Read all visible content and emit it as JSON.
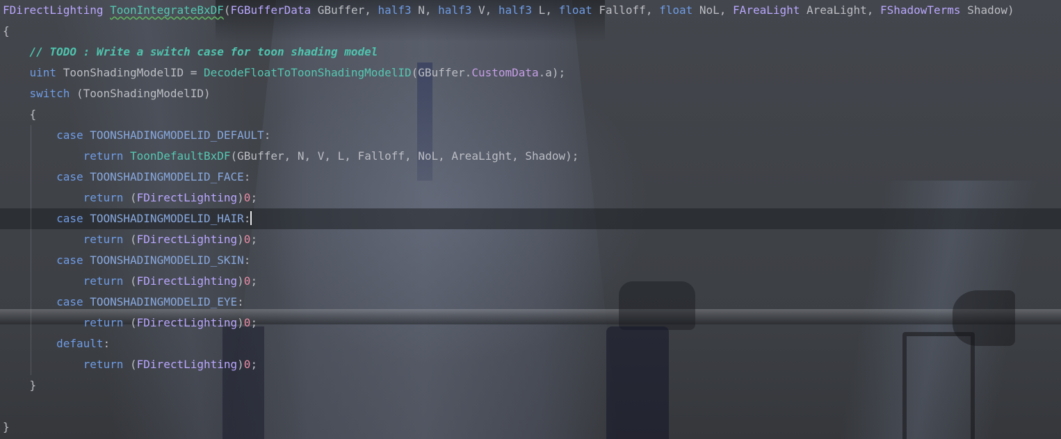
{
  "editor": {
    "lines": [
      [
        [
          "FDirectLighting",
          "ty"
        ],
        [
          " ",
          "id"
        ],
        [
          "ToonIntegrateBxDF",
          "fn squiggle"
        ],
        [
          "(",
          "id"
        ],
        [
          "FGBufferData",
          "ty"
        ],
        [
          " GBuffer, ",
          "id"
        ],
        [
          "half3",
          "kw"
        ],
        [
          " N, ",
          "id"
        ],
        [
          "half3",
          "kw"
        ],
        [
          " V, ",
          "id"
        ],
        [
          "half3",
          "kw"
        ],
        [
          " L, ",
          "id"
        ],
        [
          "float",
          "kw"
        ],
        [
          " Falloff, ",
          "id"
        ],
        [
          "float",
          "kw"
        ],
        [
          " NoL, ",
          "id"
        ],
        [
          "FAreaLight",
          "ty"
        ],
        [
          " AreaLight, ",
          "id"
        ],
        [
          "FShadowTerms",
          "ty"
        ],
        [
          " Shadow)",
          "id"
        ]
      ],
      [
        [
          "{",
          "id"
        ]
      ],
      [
        [
          "    ",
          "id"
        ],
        [
          "// TODO : Write a switch case for toon shading model",
          "cm"
        ]
      ],
      [
        [
          "    ",
          "id"
        ],
        [
          "uint",
          "kw"
        ],
        [
          " ToonShadingModelID = ",
          "id"
        ],
        [
          "DecodeFloatToToonShadingModelID",
          "fn"
        ],
        [
          "(GBuffer.",
          "id"
        ],
        [
          "CustomData",
          "fld"
        ],
        [
          ".a);",
          "id"
        ]
      ],
      [
        [
          "    ",
          "id"
        ],
        [
          "switch",
          "kw"
        ],
        [
          " (ToonShadingModelID)",
          "id"
        ]
      ],
      [
        [
          "    {",
          "id"
        ]
      ],
      [
        [
          "        ",
          "id"
        ],
        [
          "case",
          "kw"
        ],
        [
          " ",
          "id"
        ],
        [
          "TOONSHADINGMODELID_DEFAULT",
          "mac"
        ],
        [
          ":",
          "id"
        ]
      ],
      [
        [
          "            ",
          "id"
        ],
        [
          "return",
          "kw"
        ],
        [
          " ",
          "id"
        ],
        [
          "ToonDefaultBxDF",
          "fn"
        ],
        [
          "(GBuffer, N, V, L, Falloff, NoL, AreaLight, Shadow);",
          "id"
        ]
      ],
      [
        [
          "        ",
          "id"
        ],
        [
          "case",
          "kw"
        ],
        [
          " ",
          "id"
        ],
        [
          "TOONSHADINGMODELID_FACE",
          "mac"
        ],
        [
          ":",
          "id"
        ]
      ],
      [
        [
          "            ",
          "id"
        ],
        [
          "return",
          "kw"
        ],
        [
          " (",
          "id"
        ],
        [
          "FDirectLighting",
          "ty"
        ],
        [
          ")",
          "id"
        ],
        [
          "0",
          "num"
        ],
        [
          ";",
          "id"
        ]
      ],
      [
        [
          "        ",
          "id"
        ],
        [
          "case",
          "kw"
        ],
        [
          " ",
          "id"
        ],
        [
          "TOONSHADINGMODELID_HAIR",
          "mac"
        ],
        [
          ":",
          "id"
        ]
      ],
      [
        [
          "            ",
          "id"
        ],
        [
          "return",
          "kw"
        ],
        [
          " (",
          "id"
        ],
        [
          "FDirectLighting",
          "ty"
        ],
        [
          ")",
          "id"
        ],
        [
          "0",
          "num"
        ],
        [
          ";",
          "id"
        ]
      ],
      [
        [
          "        ",
          "id"
        ],
        [
          "case",
          "kw"
        ],
        [
          " ",
          "id"
        ],
        [
          "TOONSHADINGMODELID_SKIN",
          "mac"
        ],
        [
          ":",
          "id"
        ]
      ],
      [
        [
          "            ",
          "id"
        ],
        [
          "return",
          "kw"
        ],
        [
          " (",
          "id"
        ],
        [
          "FDirectLighting",
          "ty"
        ],
        [
          ")",
          "id"
        ],
        [
          "0",
          "num"
        ],
        [
          ";",
          "id"
        ]
      ],
      [
        [
          "        ",
          "id"
        ],
        [
          "case",
          "kw"
        ],
        [
          " ",
          "id"
        ],
        [
          "TOONSHADINGMODELID_EYE",
          "mac"
        ],
        [
          ":",
          "id"
        ]
      ],
      [
        [
          "            ",
          "id"
        ],
        [
          "return",
          "kw"
        ],
        [
          " (",
          "id"
        ],
        [
          "FDirectLighting",
          "ty"
        ],
        [
          ")",
          "id"
        ],
        [
          "0",
          "num"
        ],
        [
          ";",
          "id"
        ]
      ],
      [
        [
          "        ",
          "id"
        ],
        [
          "default",
          "kw"
        ],
        [
          ":",
          "id"
        ]
      ],
      [
        [
          "            ",
          "id"
        ],
        [
          "return",
          "kw"
        ],
        [
          " (",
          "id"
        ],
        [
          "FDirectLighting",
          "ty"
        ],
        [
          ")",
          "id"
        ],
        [
          "0",
          "num"
        ],
        [
          ";",
          "id"
        ]
      ],
      [
        [
          "    }",
          "id"
        ]
      ],
      [
        [
          "",
          "id"
        ]
      ],
      [
        [
          "}",
          "id"
        ]
      ]
    ],
    "current_line": 10,
    "caret_after_col": 28,
    "colors": {
      "keyword": "#6f9ce6",
      "type": "#b9a7ff",
      "function": "#55c8b2",
      "macro": "#88a8de",
      "field": "#c79ee6",
      "number": "#e88aa4",
      "comment": "#4fc4ae",
      "identifier": "#bcbec4"
    }
  }
}
